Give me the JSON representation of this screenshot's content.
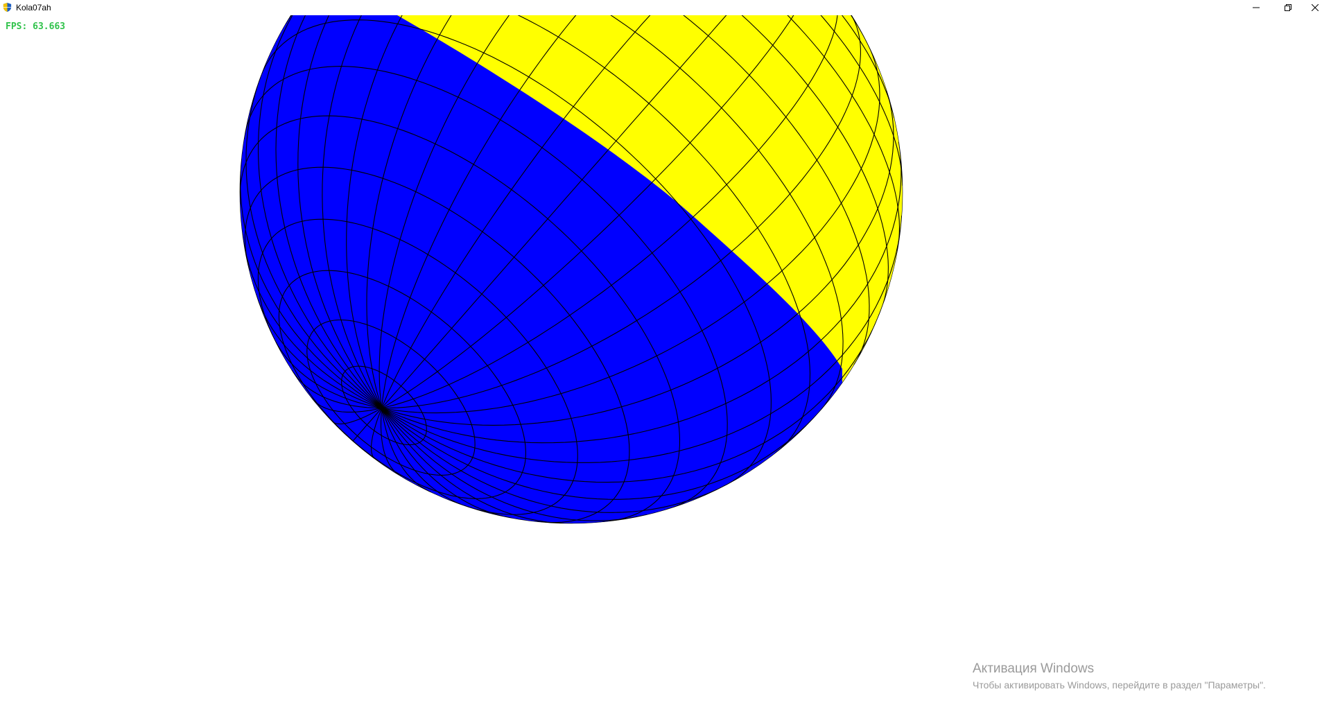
{
  "window": {
    "title": "Kola07ah",
    "icon": "shield-icon"
  },
  "controls": {
    "minimize_icon": "minimize-icon",
    "maximize_icon": "restore-icon",
    "close_icon": "close-icon"
  },
  "overlay": {
    "fps_text": "FPS: 63.663"
  },
  "scene": {
    "object": "sphere",
    "colors": {
      "band_a": "#0000ff",
      "band_b": "#ffff00",
      "grid_lines": "#000000",
      "background": "#ffffff",
      "fps_text": "#2fc24a"
    }
  },
  "watermark": {
    "title": "Активация Windows",
    "text": "Чтобы активировать Windows, перейдите в раздел \"Параметры\"."
  }
}
